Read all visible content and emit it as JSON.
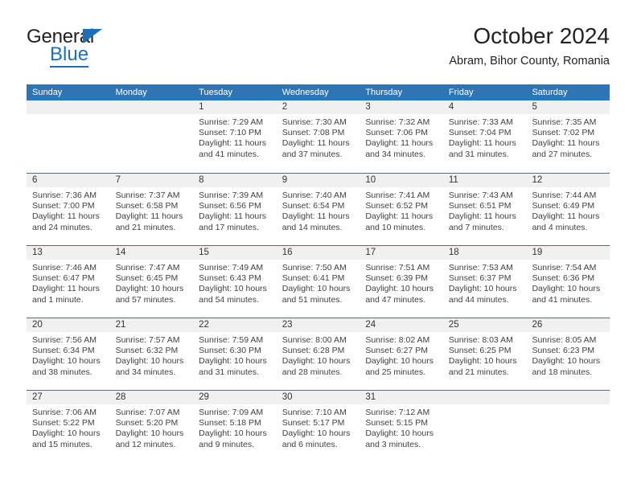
{
  "brand": {
    "name_top": "General",
    "name_bottom": "Blue",
    "accent_color": "#1d70b8"
  },
  "header": {
    "month_title": "October 2024",
    "location": "Abram, Bihor County, Romania"
  },
  "theme": {
    "header_row_bg": "#2e75b6",
    "header_row_text": "#ffffff",
    "day_number_band_bg": "#f0f0f0",
    "grid_line": "#2e75b6"
  },
  "calendar": {
    "weekday_headers": [
      "Sunday",
      "Monday",
      "Tuesday",
      "Wednesday",
      "Thursday",
      "Friday",
      "Saturday"
    ],
    "labels": {
      "sunrise_prefix": "Sunrise:",
      "sunset_prefix": "Sunset:",
      "daylight_prefix": "Daylight:"
    },
    "weeks": [
      [
        {
          "day": "",
          "sunrise": "",
          "sunset": "",
          "daylight_line1": "",
          "daylight_line2": ""
        },
        {
          "day": "",
          "sunrise": "",
          "sunset": "",
          "daylight_line1": "",
          "daylight_line2": ""
        },
        {
          "day": "1",
          "sunrise": "Sunrise: 7:29 AM",
          "sunset": "Sunset: 7:10 PM",
          "daylight_line1": "Daylight: 11 hours",
          "daylight_line2": "and 41 minutes."
        },
        {
          "day": "2",
          "sunrise": "Sunrise: 7:30 AM",
          "sunset": "Sunset: 7:08 PM",
          "daylight_line1": "Daylight: 11 hours",
          "daylight_line2": "and 37 minutes."
        },
        {
          "day": "3",
          "sunrise": "Sunrise: 7:32 AM",
          "sunset": "Sunset: 7:06 PM",
          "daylight_line1": "Daylight: 11 hours",
          "daylight_line2": "and 34 minutes."
        },
        {
          "day": "4",
          "sunrise": "Sunrise: 7:33 AM",
          "sunset": "Sunset: 7:04 PM",
          "daylight_line1": "Daylight: 11 hours",
          "daylight_line2": "and 31 minutes."
        },
        {
          "day": "5",
          "sunrise": "Sunrise: 7:35 AM",
          "sunset": "Sunset: 7:02 PM",
          "daylight_line1": "Daylight: 11 hours",
          "daylight_line2": "and 27 minutes."
        }
      ],
      [
        {
          "day": "6",
          "sunrise": "Sunrise: 7:36 AM",
          "sunset": "Sunset: 7:00 PM",
          "daylight_line1": "Daylight: 11 hours",
          "daylight_line2": "and 24 minutes."
        },
        {
          "day": "7",
          "sunrise": "Sunrise: 7:37 AM",
          "sunset": "Sunset: 6:58 PM",
          "daylight_line1": "Daylight: 11 hours",
          "daylight_line2": "and 21 minutes."
        },
        {
          "day": "8",
          "sunrise": "Sunrise: 7:39 AM",
          "sunset": "Sunset: 6:56 PM",
          "daylight_line1": "Daylight: 11 hours",
          "daylight_line2": "and 17 minutes."
        },
        {
          "day": "9",
          "sunrise": "Sunrise: 7:40 AM",
          "sunset": "Sunset: 6:54 PM",
          "daylight_line1": "Daylight: 11 hours",
          "daylight_line2": "and 14 minutes."
        },
        {
          "day": "10",
          "sunrise": "Sunrise: 7:41 AM",
          "sunset": "Sunset: 6:52 PM",
          "daylight_line1": "Daylight: 11 hours",
          "daylight_line2": "and 10 minutes."
        },
        {
          "day": "11",
          "sunrise": "Sunrise: 7:43 AM",
          "sunset": "Sunset: 6:51 PM",
          "daylight_line1": "Daylight: 11 hours",
          "daylight_line2": "and 7 minutes."
        },
        {
          "day": "12",
          "sunrise": "Sunrise: 7:44 AM",
          "sunset": "Sunset: 6:49 PM",
          "daylight_line1": "Daylight: 11 hours",
          "daylight_line2": "and 4 minutes."
        }
      ],
      [
        {
          "day": "13",
          "sunrise": "Sunrise: 7:46 AM",
          "sunset": "Sunset: 6:47 PM",
          "daylight_line1": "Daylight: 11 hours",
          "daylight_line2": "and 1 minute."
        },
        {
          "day": "14",
          "sunrise": "Sunrise: 7:47 AM",
          "sunset": "Sunset: 6:45 PM",
          "daylight_line1": "Daylight: 10 hours",
          "daylight_line2": "and 57 minutes."
        },
        {
          "day": "15",
          "sunrise": "Sunrise: 7:49 AM",
          "sunset": "Sunset: 6:43 PM",
          "daylight_line1": "Daylight: 10 hours",
          "daylight_line2": "and 54 minutes."
        },
        {
          "day": "16",
          "sunrise": "Sunrise: 7:50 AM",
          "sunset": "Sunset: 6:41 PM",
          "daylight_line1": "Daylight: 10 hours",
          "daylight_line2": "and 51 minutes."
        },
        {
          "day": "17",
          "sunrise": "Sunrise: 7:51 AM",
          "sunset": "Sunset: 6:39 PM",
          "daylight_line1": "Daylight: 10 hours",
          "daylight_line2": "and 47 minutes."
        },
        {
          "day": "18",
          "sunrise": "Sunrise: 7:53 AM",
          "sunset": "Sunset: 6:37 PM",
          "daylight_line1": "Daylight: 10 hours",
          "daylight_line2": "and 44 minutes."
        },
        {
          "day": "19",
          "sunrise": "Sunrise: 7:54 AM",
          "sunset": "Sunset: 6:36 PM",
          "daylight_line1": "Daylight: 10 hours",
          "daylight_line2": "and 41 minutes."
        }
      ],
      [
        {
          "day": "20",
          "sunrise": "Sunrise: 7:56 AM",
          "sunset": "Sunset: 6:34 PM",
          "daylight_line1": "Daylight: 10 hours",
          "daylight_line2": "and 38 minutes."
        },
        {
          "day": "21",
          "sunrise": "Sunrise: 7:57 AM",
          "sunset": "Sunset: 6:32 PM",
          "daylight_line1": "Daylight: 10 hours",
          "daylight_line2": "and 34 minutes."
        },
        {
          "day": "22",
          "sunrise": "Sunrise: 7:59 AM",
          "sunset": "Sunset: 6:30 PM",
          "daylight_line1": "Daylight: 10 hours",
          "daylight_line2": "and 31 minutes."
        },
        {
          "day": "23",
          "sunrise": "Sunrise: 8:00 AM",
          "sunset": "Sunset: 6:28 PM",
          "daylight_line1": "Daylight: 10 hours",
          "daylight_line2": "and 28 minutes."
        },
        {
          "day": "24",
          "sunrise": "Sunrise: 8:02 AM",
          "sunset": "Sunset: 6:27 PM",
          "daylight_line1": "Daylight: 10 hours",
          "daylight_line2": "and 25 minutes."
        },
        {
          "day": "25",
          "sunrise": "Sunrise: 8:03 AM",
          "sunset": "Sunset: 6:25 PM",
          "daylight_line1": "Daylight: 10 hours",
          "daylight_line2": "and 21 minutes."
        },
        {
          "day": "26",
          "sunrise": "Sunrise: 8:05 AM",
          "sunset": "Sunset: 6:23 PM",
          "daylight_line1": "Daylight: 10 hours",
          "daylight_line2": "and 18 minutes."
        }
      ],
      [
        {
          "day": "27",
          "sunrise": "Sunrise: 7:06 AM",
          "sunset": "Sunset: 5:22 PM",
          "daylight_line1": "Daylight: 10 hours",
          "daylight_line2": "and 15 minutes."
        },
        {
          "day": "28",
          "sunrise": "Sunrise: 7:07 AM",
          "sunset": "Sunset: 5:20 PM",
          "daylight_line1": "Daylight: 10 hours",
          "daylight_line2": "and 12 minutes."
        },
        {
          "day": "29",
          "sunrise": "Sunrise: 7:09 AM",
          "sunset": "Sunset: 5:18 PM",
          "daylight_line1": "Daylight: 10 hours",
          "daylight_line2": "and 9 minutes."
        },
        {
          "day": "30",
          "sunrise": "Sunrise: 7:10 AM",
          "sunset": "Sunset: 5:17 PM",
          "daylight_line1": "Daylight: 10 hours",
          "daylight_line2": "and 6 minutes."
        },
        {
          "day": "31",
          "sunrise": "Sunrise: 7:12 AM",
          "sunset": "Sunset: 5:15 PM",
          "daylight_line1": "Daylight: 10 hours",
          "daylight_line2": "and 3 minutes."
        },
        {
          "day": "",
          "sunrise": "",
          "sunset": "",
          "daylight_line1": "",
          "daylight_line2": ""
        },
        {
          "day": "",
          "sunrise": "",
          "sunset": "",
          "daylight_line1": "",
          "daylight_line2": ""
        }
      ]
    ]
  }
}
